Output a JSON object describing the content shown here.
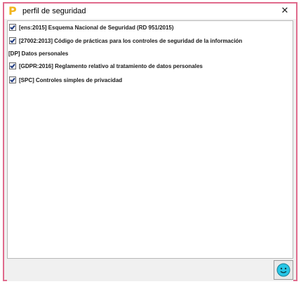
{
  "window": {
    "title": "perfil de seguridad",
    "close_label": "✕",
    "app_icon_glyph": "P",
    "border_color": "#e06a8c",
    "icon_color": "#f2b51d"
  },
  "items": [
    {
      "label": "[ens:2015] Esquema Nacional de Seguridad (RD 951/2015)",
      "checked": true
    },
    {
      "label": "[27002:2013] Código de prácticas para los controles de seguridad de la información",
      "checked": true
    },
    {
      "label": "[DP] Datos personales",
      "checked": null
    },
    {
      "label": "[GDPR:2016] Reglamento relativo al tratamiento de datos personales",
      "checked": true
    },
    {
      "label": "[SPC] Controles simples de privacidad",
      "checked": true
    }
  ],
  "footer": {
    "action_icon": "smiley-icon",
    "action_color": "#27c6e6"
  }
}
